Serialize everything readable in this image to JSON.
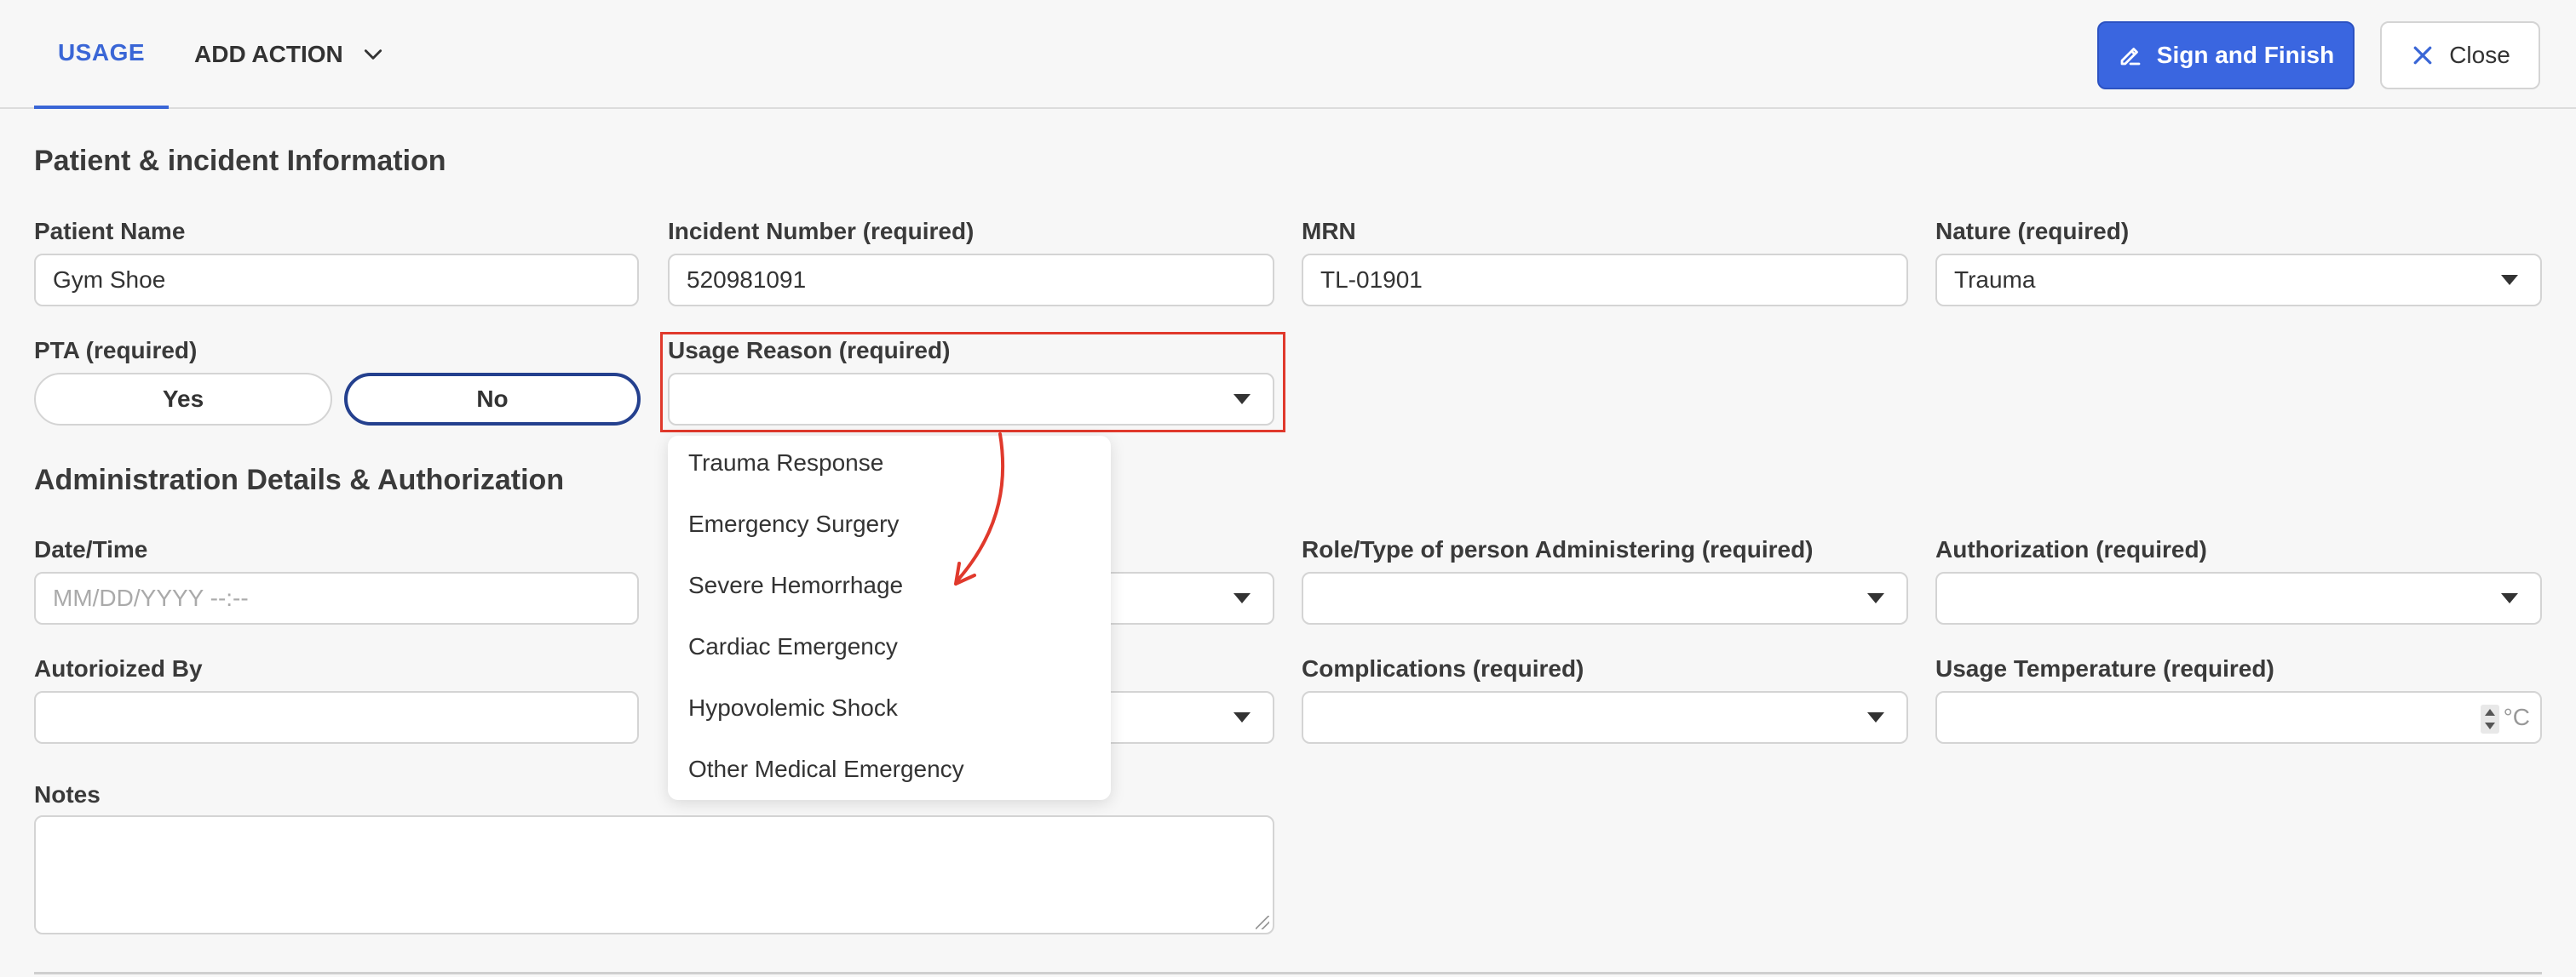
{
  "header": {
    "tabs": [
      {
        "label": "USAGE",
        "active": true
      },
      {
        "label": "ADD ACTION",
        "active": false
      }
    ],
    "sign_label": "Sign and Finish",
    "close_label": "Close",
    "accent_color": "#3a66e0"
  },
  "patient_section": {
    "title": "Patient & incident Information",
    "patient_name": {
      "label": "Patient Name",
      "value": "Gym Shoe"
    },
    "incident_number": {
      "label": "Incident Number (required)",
      "value": "520981091"
    },
    "mrn": {
      "label": "MRN",
      "value": "TL-01901"
    },
    "nature": {
      "label": "Nature (required)",
      "value": "Trauma"
    },
    "pta": {
      "label": "PTA (required)",
      "options": [
        "Yes",
        "No"
      ],
      "selected": "No"
    },
    "usage_reason": {
      "label": "Usage Reason (required)",
      "value": "",
      "options": [
        "Trauma Response",
        "Emergency Surgery",
        "Severe Hemorrhage",
        "Cardiac Emergency",
        "Hypovolemic Shock",
        "Other Medical Emergency"
      ]
    }
  },
  "admin_section": {
    "title": "Administration Details & Authorization",
    "datetime": {
      "label": "Date/Time",
      "placeholder": "MM/DD/YYYY --:--"
    },
    "role": {
      "label": "Role/Type of person Administering (required)",
      "value": ""
    },
    "authorization": {
      "label": "Authorization (required)",
      "value": ""
    },
    "authorized_by": {
      "label": "Autorioized By",
      "value": ""
    },
    "complications": {
      "label": "Complications (required)",
      "value": ""
    },
    "usage_temperature": {
      "label": "Usage Temperature (required)",
      "value": "",
      "unit": "°C"
    },
    "notes": {
      "label": "Notes",
      "value": ""
    }
  }
}
